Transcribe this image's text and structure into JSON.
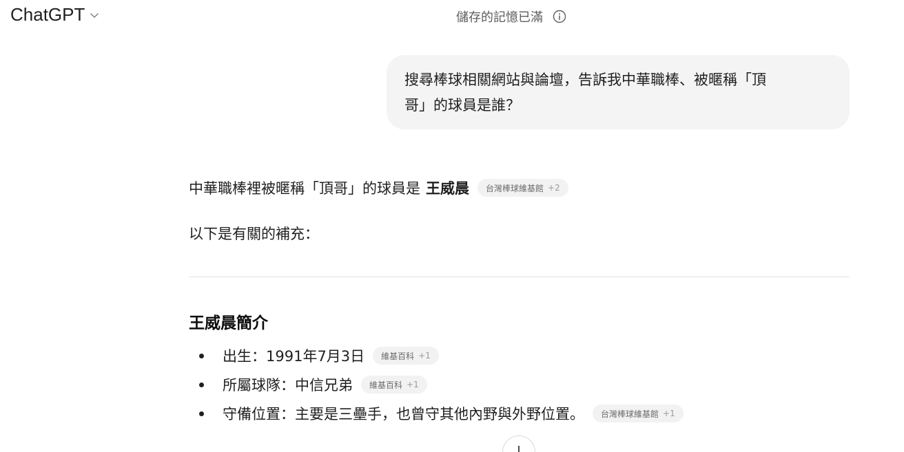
{
  "header": {
    "title": "ChatGPT",
    "memory_status": "儲存的記憶已滿"
  },
  "user_message": {
    "line1": "搜尋棒球相關網站與論壇，告訴我中華職棒、被暱稱「頂",
    "line2": "哥」的球員是誰？"
  },
  "assistant": {
    "intro_prefix": "中華職棒裡被暱稱「頂哥」的球員是",
    "intro_name": "王威晨",
    "intro_citation": {
      "source": "台灣棒球維基館",
      "more": "+2"
    },
    "supplement": "以下是有關的補充：",
    "section_title": "王威晨簡介",
    "bullets": [
      {
        "text": "出生：1991年7月3日",
        "citation": {
          "source": "維基百科",
          "more": "+1"
        }
      },
      {
        "text": "所屬球隊：中信兄弟",
        "citation": {
          "source": "維基百科",
          "more": "+1"
        }
      },
      {
        "text": "守備位置：主要是三壘手，也曾守其他內野與外野位置。",
        "citation": {
          "source": "台灣棒球維基館",
          "more": "+1"
        }
      }
    ]
  },
  "icons": {
    "model_menu": "chevron-down-icon",
    "memory_info": "info-icon",
    "scroll_down": "arrow-down-icon"
  }
}
